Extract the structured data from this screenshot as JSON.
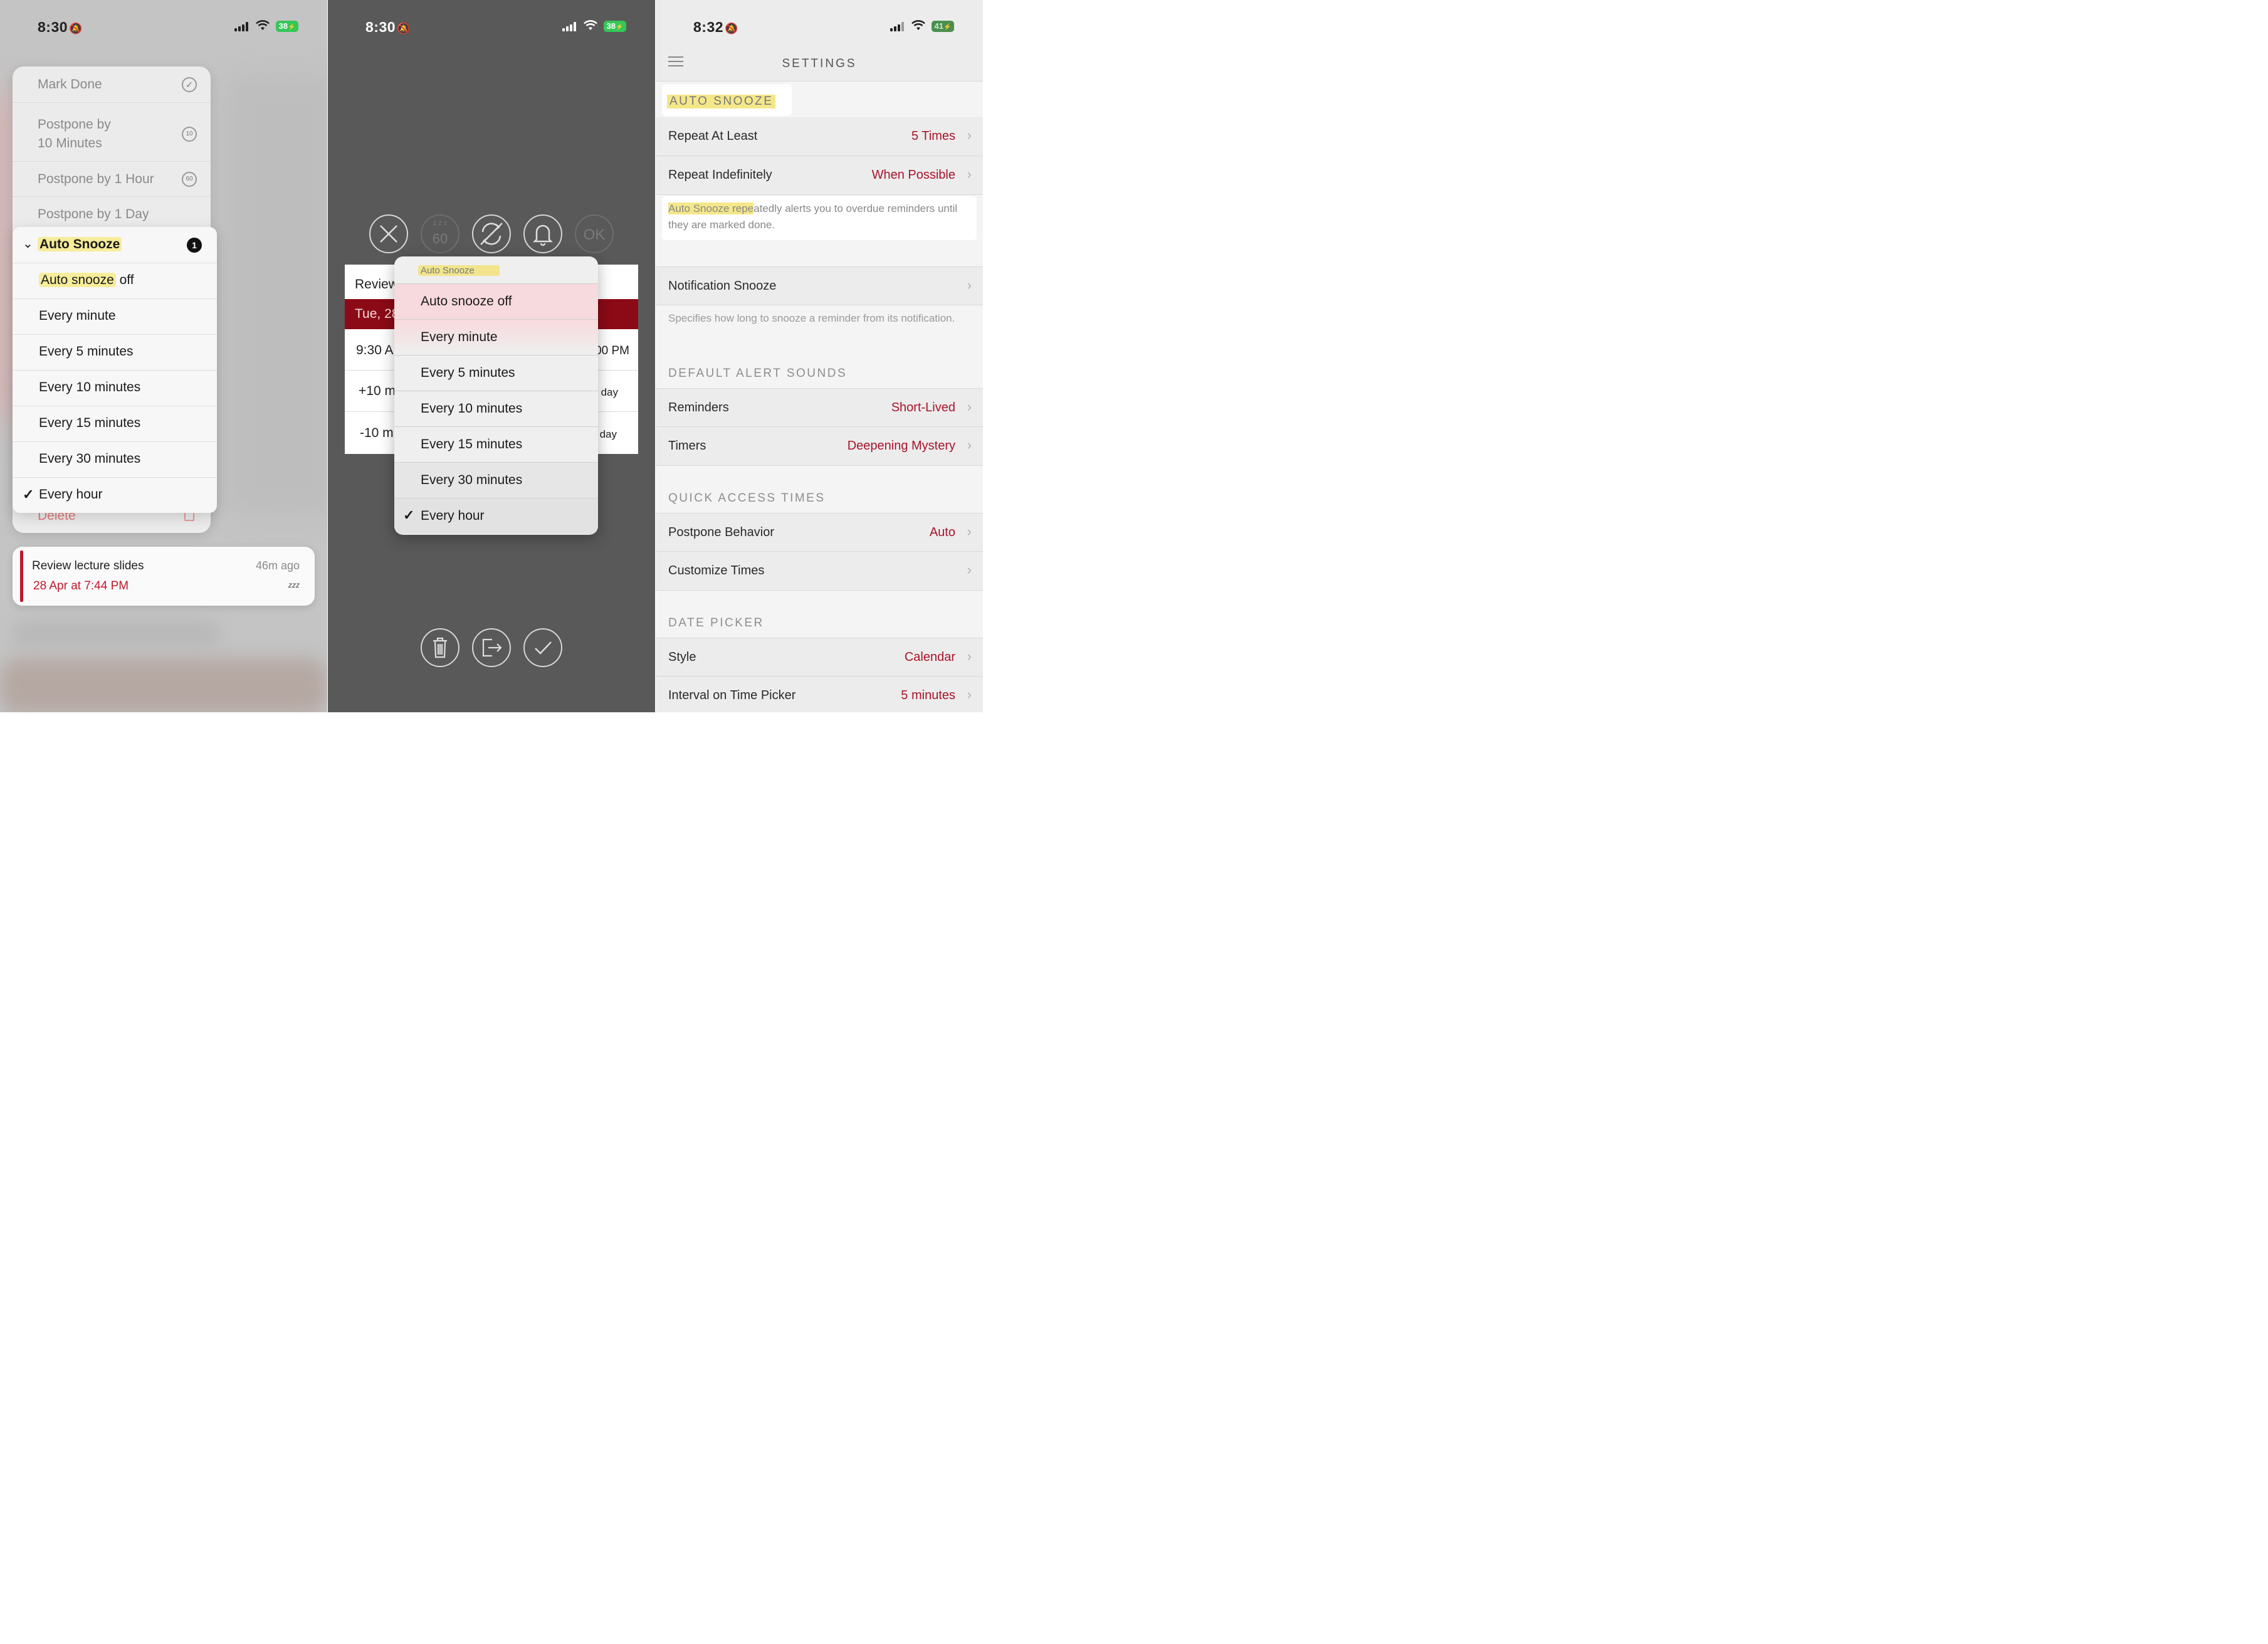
{
  "screen1": {
    "status": {
      "time": "8:30",
      "battery": "38"
    },
    "menu": {
      "mark_done": "Mark Done",
      "postpone_10_line1": "Postpone by",
      "postpone_10_line2": "10 Minutes",
      "postpone_10_icon": "10",
      "postpone_1h": "Postpone by 1 Hour",
      "postpone_1h_icon": "60",
      "postpone_1d": "Postpone by 1 Day",
      "delete": "Delete"
    },
    "submenu": {
      "header": "Auto Snooze",
      "badge": "1",
      "items": [
        {
          "prefix": "Auto snooze",
          "suffix": " off"
        },
        {
          "label": "Every minute"
        },
        {
          "label": "Every 5 minutes"
        },
        {
          "label": "Every 10 minutes"
        },
        {
          "label": "Every 15 minutes"
        },
        {
          "label": "Every 30 minutes"
        },
        {
          "label": "Every hour",
          "check": "✓"
        }
      ]
    },
    "notification": {
      "title": "Review lecture slides",
      "ago": "46m ago",
      "date": "28 Apr at 7:44 PM",
      "snooze_glyph": "zzz"
    }
  },
  "screen2": {
    "status": {
      "time": "8:30",
      "battery": "38"
    },
    "buttons": {
      "snooze_label": "60",
      "ok_label": "OK",
      "zzz": "z z z"
    },
    "card": {
      "title": "Review",
      "date": "Tue, 28",
      "time_left": "9:30 A",
      "time_right": "00 PM",
      "plus10": "+10 m",
      "minus10": "-10 mi",
      "day1": "day",
      "day2": "day"
    },
    "popup": {
      "header": "Auto Snooze",
      "items": [
        "Auto snooze off",
        "Every minute",
        "Every 5 minutes",
        "Every 10 minutes",
        "Every 15 minutes",
        "Every 30 minutes",
        "Every hour"
      ],
      "check": "✓"
    }
  },
  "screen3": {
    "status": {
      "time": "8:32",
      "battery": "41"
    },
    "title": "SETTINGS",
    "auto_snooze_header": "AUTO SNOOZE",
    "repeat_at_least": {
      "label": "Repeat At Least",
      "value": "5 Times"
    },
    "repeat_indefinitely": {
      "label": "Repeat Indefinitely",
      "value": "When Possible"
    },
    "auto_snooze_footer_hl": "Auto Snooze repe",
    "auto_snooze_footer_rest": "atedly alerts you to overdue reminders until they are marked done.",
    "notification_snooze": {
      "label": "Notification Snooze"
    },
    "notification_snooze_footer": "Specifies how long to snooze a reminder from its notification.",
    "default_alert_sounds": "DEFAULT ALERT SOUNDS",
    "reminders": {
      "label": "Reminders",
      "value": "Short-Lived"
    },
    "timers": {
      "label": "Timers",
      "value": "Deepening Mystery"
    },
    "quick_access_times": "QUICK ACCESS TIMES",
    "postpone_behavior": {
      "label": "Postpone Behavior",
      "value": "Auto"
    },
    "customize_times": {
      "label": "Customize Times"
    },
    "date_picker": "DATE PICKER",
    "style": {
      "label": "Style",
      "value": "Calendar"
    },
    "interval": {
      "label": "Interval on Time Picker",
      "value": "5 minutes"
    }
  },
  "colors": {
    "accent_red": "#a8142a",
    "highlight": "#f6ec9a",
    "battery_green": "#34c759"
  }
}
